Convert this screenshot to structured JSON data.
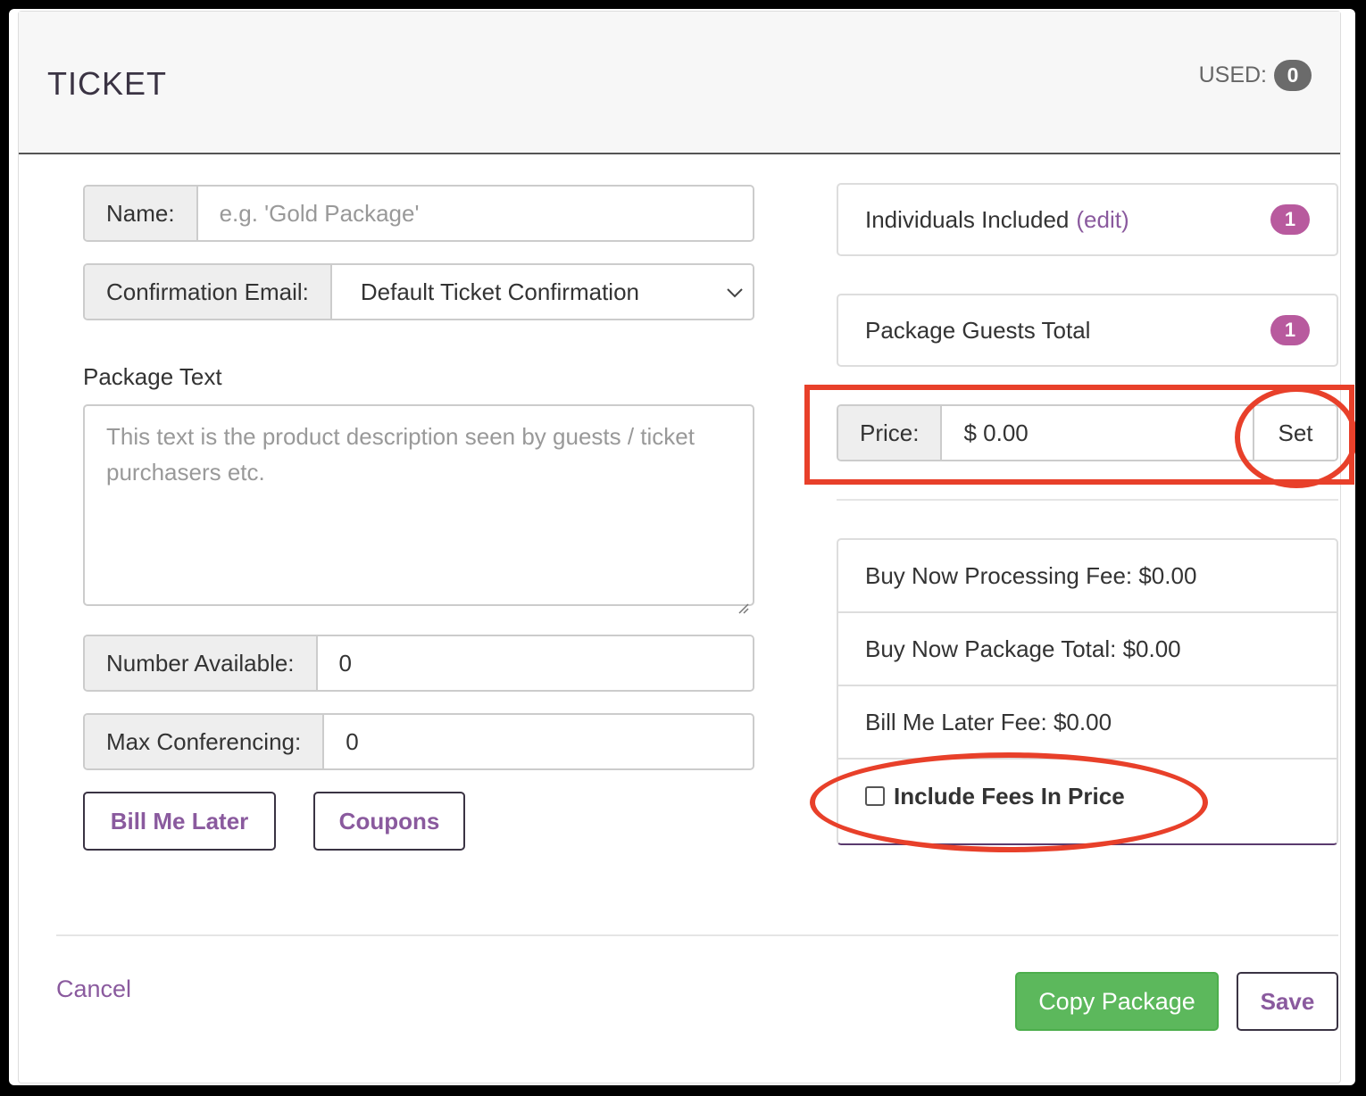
{
  "header": {
    "title": "TICKET",
    "used_label": "USED:",
    "used_count": "0"
  },
  "form": {
    "name_label": "Name:",
    "name_placeholder": "e.g. 'Gold Package'",
    "confirmation_label": "Confirmation Email:",
    "confirmation_value": "Default Ticket Confirmation",
    "package_text_label": "Package Text",
    "package_text_placeholder": "This text is the product description seen by guests / ticket purchasers etc.",
    "number_available_label": "Number Available:",
    "number_available_value": "0",
    "max_conferencing_label": "Max Conferencing:",
    "max_conferencing_value": "0",
    "bill_me_later_button": "Bill Me Later",
    "coupons_button": "Coupons"
  },
  "summary": {
    "individuals_label": "Individuals Included",
    "edit_link": "(edit)",
    "individuals_count": "1",
    "guests_label": "Package Guests Total",
    "guests_count": "1",
    "price_label": "Price:",
    "price_value": "$ 0.00",
    "set_button": "Set"
  },
  "fees": {
    "processing_fee": "Buy Now Processing Fee: $0.00",
    "package_total": "Buy Now Package Total: $0.00",
    "bill_later_fee": "Bill Me Later Fee: $0.00",
    "include_fees_label": "Include Fees In Price",
    "include_fees_checked": false
  },
  "footer": {
    "cancel": "Cancel",
    "copy_package": "Copy Package",
    "save": "Save"
  },
  "colors": {
    "accent_purple": "#8a5a9e",
    "badge_purple": "#b85a9e",
    "success_green": "#5cb85c",
    "annotation_red": "#e8402a"
  }
}
